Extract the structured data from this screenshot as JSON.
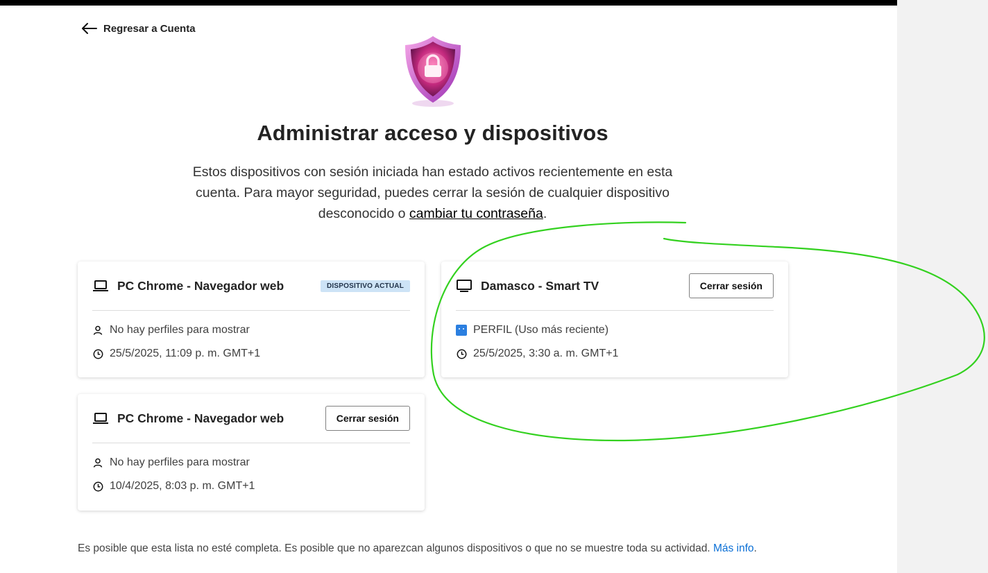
{
  "back_link": {
    "label": "Regresar a Cuenta"
  },
  "title": "Administrar acceso y dispositivos",
  "description": {
    "text": "Estos dispositivos con sesión iniciada han estado activos recientemente en esta cuenta. Para mayor seguridad, puedes cerrar la sesión de cualquier dispositivo desconocido o ",
    "link_text": "cambiar tu contraseña",
    "suffix": "."
  },
  "devices": [
    {
      "name": "PC Chrome - Navegador web",
      "badge": "DISPOSITIVO ACTUAL",
      "profile": "No hay perfiles para mostrar",
      "last_active": "25/5/2025, 11:09 p. m. GMT+1",
      "icon": "laptop-icon"
    },
    {
      "name": "Damasco - Smart TV",
      "button": "Cerrar sesión",
      "profile": "PERFIL (Uso más reciente)",
      "last_active": "25/5/2025, 3:30 a. m. GMT+1",
      "icon": "tv-icon"
    },
    {
      "name": "PC Chrome - Navegador web",
      "button": "Cerrar sesión",
      "profile": "No hay perfiles para mostrar",
      "last_active": "10/4/2025, 8:03 p. m. GMT+1",
      "icon": "laptop-icon"
    }
  ],
  "footer": {
    "text": "Es posible que esta lista no esté completa. Es posible que no aparezcan algunos dispositivos o que no se muestre toda su actividad. ",
    "link_text": "Más info",
    "suffix": "."
  },
  "colors": {
    "badge_bg": "#cde3f6",
    "link_blue": "#0a6fd6",
    "annotation_green": "#33d11f",
    "shield_pink": "#d6359a"
  }
}
